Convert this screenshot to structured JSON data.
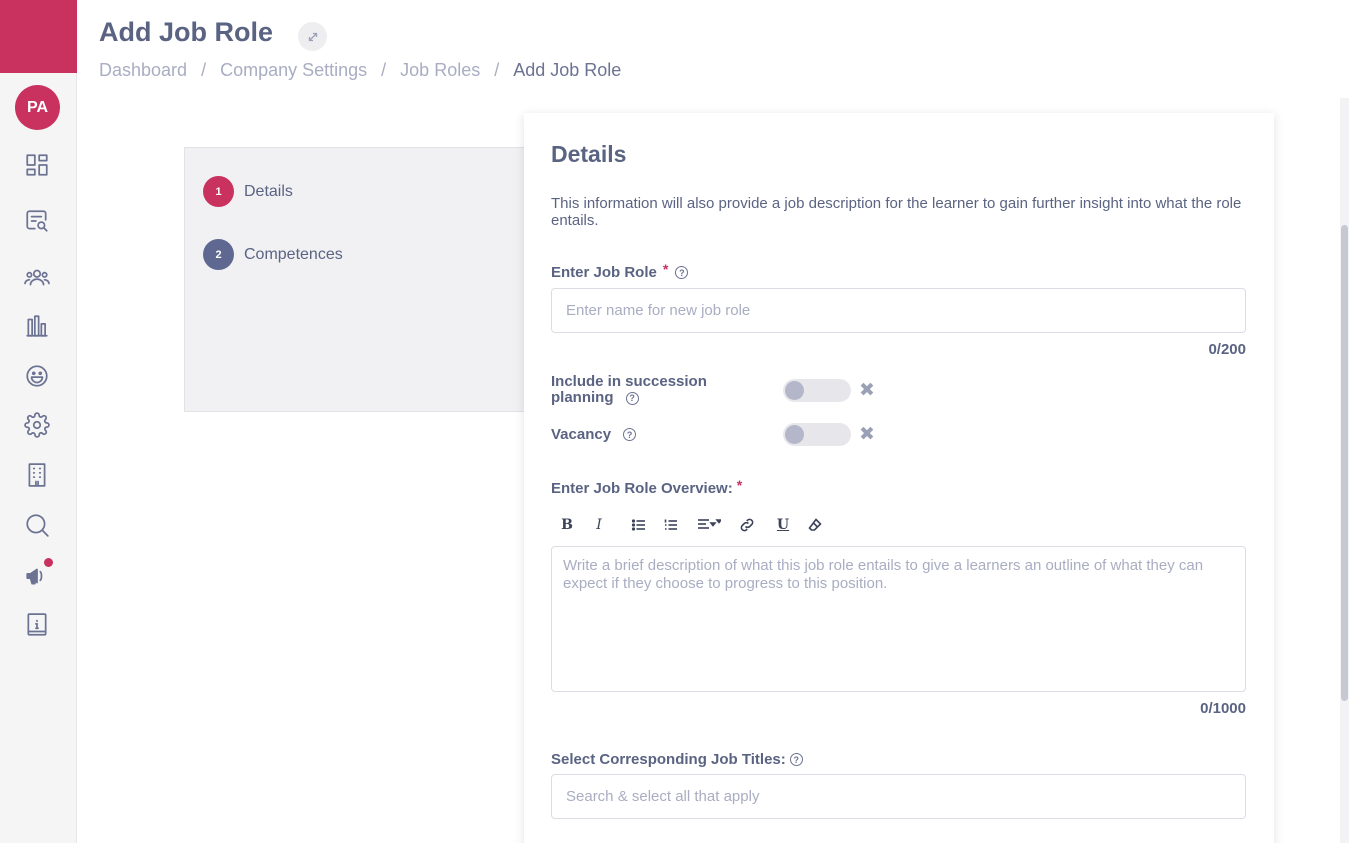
{
  "sidebar": {
    "avatar_initials": "PA",
    "nav_icons": [
      "dashboard-icon",
      "search-report-icon",
      "users-icon",
      "chart-icon",
      "smiley-icon",
      "gear-icon",
      "building-icon",
      "search-icon",
      "megaphone-icon",
      "info-book-icon"
    ],
    "brand_color": "#c9325f"
  },
  "header": {
    "title": "Add Job Role",
    "breadcrumb": [
      "Dashboard",
      "Company Settings",
      "Job Roles",
      "Add Job Role"
    ],
    "breadcrumb_separator": "/"
  },
  "stepper": {
    "steps": [
      {
        "number": "1",
        "label": "Details",
        "active": true
      },
      {
        "number": "2",
        "label": "Competences",
        "active": false
      }
    ]
  },
  "details": {
    "title": "Details",
    "description": "This information will also provide a job description for the learner to gain further insight into what the role entails.",
    "job_role": {
      "label": "Enter Job Role",
      "required_mark": "*",
      "placeholder": "Enter name for new job role",
      "value": "",
      "counter": "0/200"
    },
    "succession": {
      "label": "Include in succession planning",
      "on": false,
      "clear_symbol": "✖"
    },
    "vacancy": {
      "label": "Vacancy",
      "on": false,
      "clear_symbol": "✖"
    },
    "overview": {
      "label": "Enter Job Role Overview:",
      "required_mark": "*",
      "toolbar": [
        "bold",
        "italic",
        "bullet-list",
        "numbered-list",
        "align",
        "link",
        "underline",
        "clear-format"
      ],
      "placeholder": "Write a brief description of what this job role entails to give a learners an outline of what they can expect if they choose to progress to this position.",
      "counter": "0/1000"
    },
    "job_titles": {
      "label": "Select Corresponding Job Titles:",
      "placeholder": "Search & select all that apply"
    }
  },
  "help_symbol": "?"
}
